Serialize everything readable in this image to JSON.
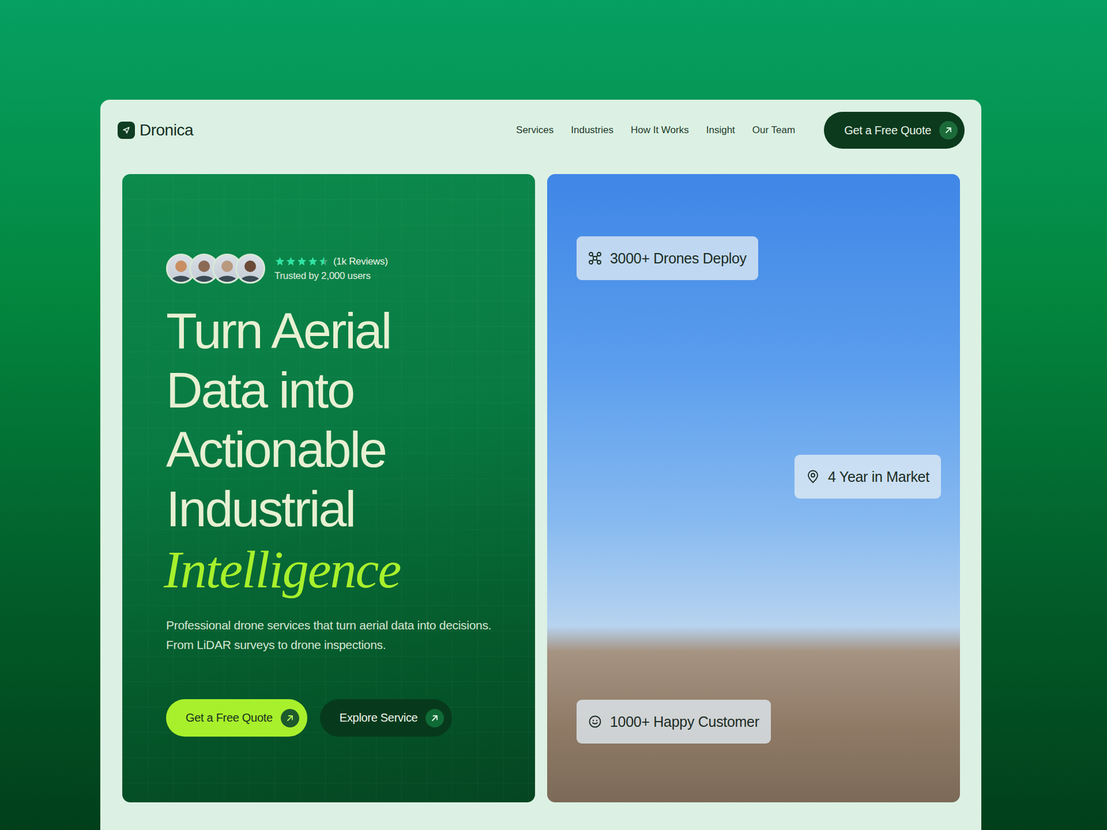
{
  "brand": {
    "name": "Dronica"
  },
  "nav": {
    "items": [
      "Services",
      "Industries",
      "How It Works",
      "Insight",
      "Our Team"
    ]
  },
  "nav_cta": {
    "label": "Get a Free Quote"
  },
  "hero": {
    "avatars": [
      {
        "color": "#c98f62"
      },
      {
        "color": "#8a6a55"
      },
      {
        "color": "#b89a80"
      },
      {
        "color": "#6b4a38"
      }
    ],
    "rating": {
      "stars": 4.5,
      "reviews": "(1k Reviews)",
      "trusted": "Trusted by 2,000 users"
    },
    "headline": {
      "lines": [
        "Turn Aerial",
        "Data into",
        "Actionable",
        "Industrial"
      ],
      "accent": "Intelligence"
    },
    "description": "Professional drone services that turn aerial data into decisions. From LiDAR surveys to drone inspections.",
    "buttons": [
      {
        "label": "Get a Free Quote",
        "kind": "primary"
      },
      {
        "label": "Explore Service",
        "kind": "secondary"
      }
    ]
  },
  "stats": [
    {
      "label": "3000+ Drones Deploy",
      "kind": "drone"
    },
    {
      "label": "4 Year in Market",
      "kind": "location"
    },
    {
      "label": "1000+ Happy Customer",
      "kind": "smile"
    }
  ]
}
